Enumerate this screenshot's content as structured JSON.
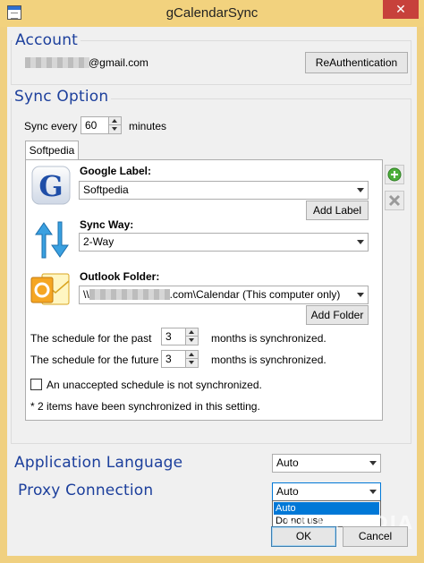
{
  "window": {
    "title": "gCalendarSync",
    "close_glyph": "✕"
  },
  "account": {
    "group_title": "Account",
    "email_suffix": "@gmail.com",
    "reauth_label": "ReAuthentication"
  },
  "sync": {
    "group_title": "Sync Option",
    "sync_every_label": "Sync every",
    "sync_every_value": "60",
    "minutes_label": "minutes",
    "tab_label": "Softpedia",
    "google_label_title": "Google Label:",
    "google_label_value": "Softpedia",
    "add_label_button": "Add Label",
    "sync_way_title": "Sync Way:",
    "sync_way_value": "2-Way",
    "outlook_folder_title": "Outlook Folder:",
    "outlook_folder_prefix": "\\\\",
    "outlook_folder_value": ".com\\Calendar (This computer only)",
    "add_folder_button": "Add Folder",
    "past_label": "The schedule for the past",
    "past_value": "3",
    "past_suffix": "months is synchronized.",
    "future_label": "The schedule for the future",
    "future_value": "3",
    "future_suffix": "months is synchronized.",
    "unaccepted_label": "An unaccepted schedule is not synchronized.",
    "status_text": "* 2 items have been synchronized in this setting."
  },
  "language": {
    "label": "Application Language",
    "value": "Auto"
  },
  "proxy": {
    "label": "Proxy Connection",
    "value": "Auto",
    "options": [
      "Auto",
      "Do not use"
    ]
  },
  "footer": {
    "ok_label": "OK",
    "cancel_label": "Cancel"
  },
  "watermark": "SOFTPEDIA",
  "colors": {
    "title_bar": "#f2d27e",
    "group_title": "#1c3f9c",
    "close": "#c7413b",
    "accent": "#0078d7"
  }
}
